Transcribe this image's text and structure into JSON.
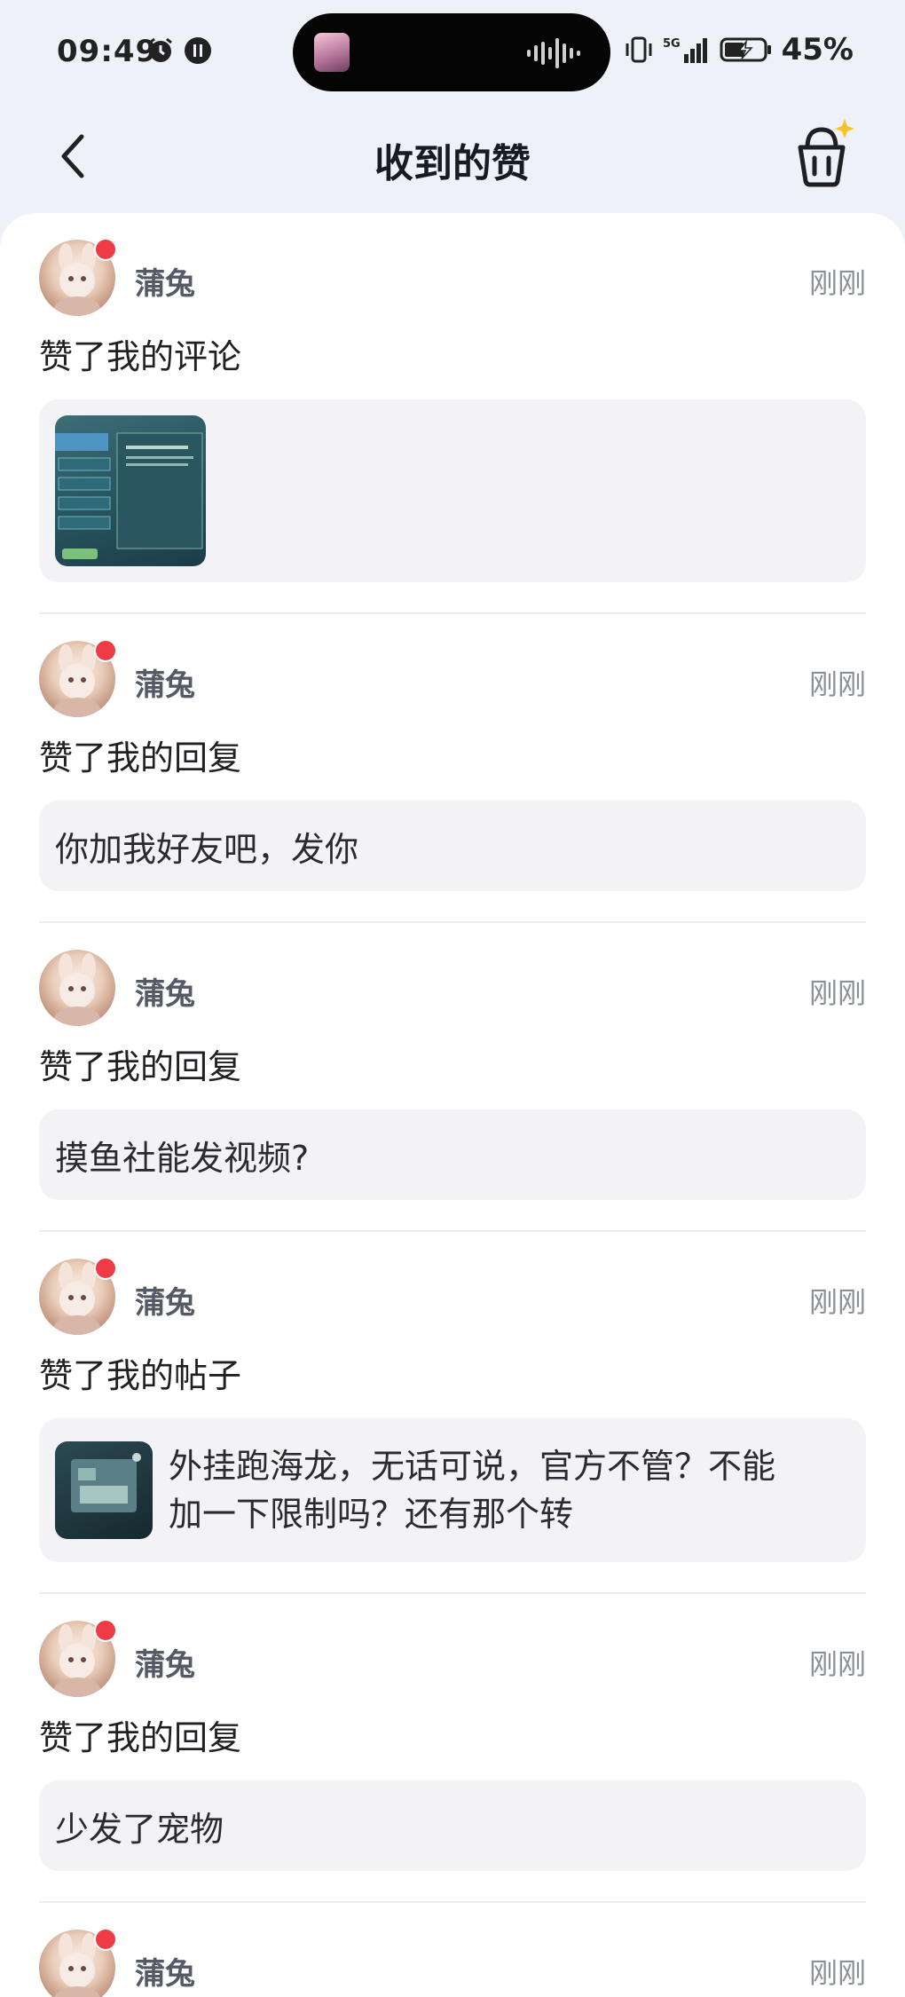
{
  "status_bar": {
    "time": "09:49",
    "battery": "45%",
    "network": "5G",
    "icons": [
      "alarm-icon",
      "notification-icon",
      "vibrate-icon",
      "signal-icon",
      "battery-charging-icon"
    ]
  },
  "header": {
    "title": "收到的赞",
    "back_icon": "chevron-left-icon",
    "right_icon": "basket-sparkle-icon"
  },
  "colors": {
    "unread_dot": "#ee3b45",
    "background": "#eef2f8",
    "quote_bg": "#f3f3f5"
  },
  "items": [
    {
      "name": "蒲兔",
      "time": "刚刚",
      "action": "赞了我的评论",
      "unread": true,
      "content_type": "image"
    },
    {
      "name": "蒲兔",
      "time": "刚刚",
      "action": "赞了我的回复",
      "unread": true,
      "content_type": "text",
      "content": "你加我好友吧，发你"
    },
    {
      "name": "蒲兔",
      "time": "刚刚",
      "action": "赞了我的回复",
      "unread": false,
      "content_type": "text",
      "content": "摸鱼社能发视频?"
    },
    {
      "name": "蒲兔",
      "time": "刚刚",
      "action": "赞了我的帖子",
      "unread": true,
      "content_type": "post",
      "content_line1": "外挂跑海龙，无话可说，官方不管？不能",
      "content_line2": "加一下限制吗？还有那个转"
    },
    {
      "name": "蒲兔",
      "time": "刚刚",
      "action": "赞了我的回复",
      "unread": true,
      "content_type": "text",
      "content": "少发了宠物"
    },
    {
      "name": "蒲兔",
      "time": "刚刚",
      "unread": true
    }
  ]
}
